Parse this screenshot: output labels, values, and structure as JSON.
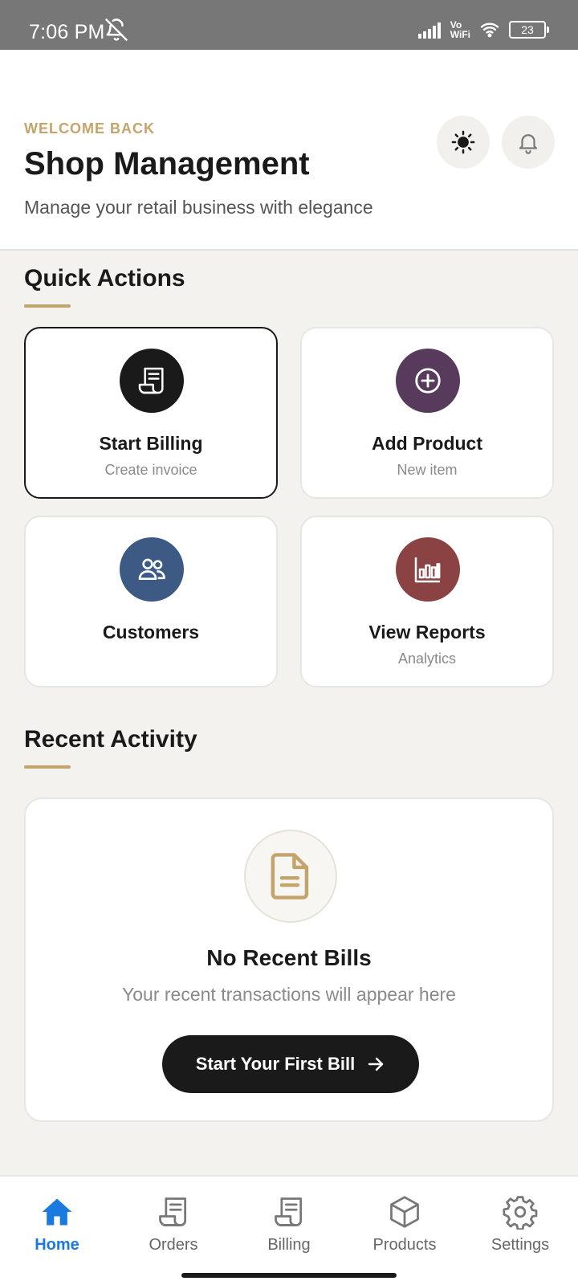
{
  "status_bar": {
    "time": "7:06 PM",
    "network_label_top": "Vo",
    "network_label_bottom": "WiFi",
    "battery": "23"
  },
  "header": {
    "eyebrow": "WELCOME BACK",
    "title": "Shop Management",
    "subtitle": "Manage your retail business with elegance",
    "theme_icon": "sun-icon",
    "notification_icon": "bell-icon"
  },
  "quick_actions": {
    "title": "Quick Actions",
    "items": [
      {
        "label": "Start Billing",
        "sub": "Create invoice",
        "icon": "receipt-icon",
        "color": "#1a1a1a"
      },
      {
        "label": "Add Product",
        "sub": "New item",
        "icon": "plus-circle-icon",
        "color": "#573a5c"
      },
      {
        "label": "Customers",
        "sub": "",
        "icon": "users-icon",
        "color": "#3c5a84"
      },
      {
        "label": "View Reports",
        "sub": "Analytics",
        "icon": "bar-chart-icon",
        "color": "#8a4242"
      }
    ]
  },
  "recent_activity": {
    "title": "Recent Activity",
    "empty_title": "No Recent Bills",
    "empty_sub": "Your recent transactions will appear here",
    "cta_label": "Start Your First Bill"
  },
  "bottom_nav": {
    "items": [
      {
        "label": "Home",
        "icon": "home-icon",
        "active": true
      },
      {
        "label": "Orders",
        "icon": "receipt-icon",
        "active": false
      },
      {
        "label": "Billing",
        "icon": "receipt-icon",
        "active": false
      },
      {
        "label": "Products",
        "icon": "box-icon",
        "active": false
      },
      {
        "label": "Settings",
        "icon": "gear-icon",
        "active": false
      }
    ]
  },
  "colors": {
    "accent_gold": "#c4a46b",
    "active_blue": "#1a7ae0",
    "dark": "#1a1a1a"
  }
}
